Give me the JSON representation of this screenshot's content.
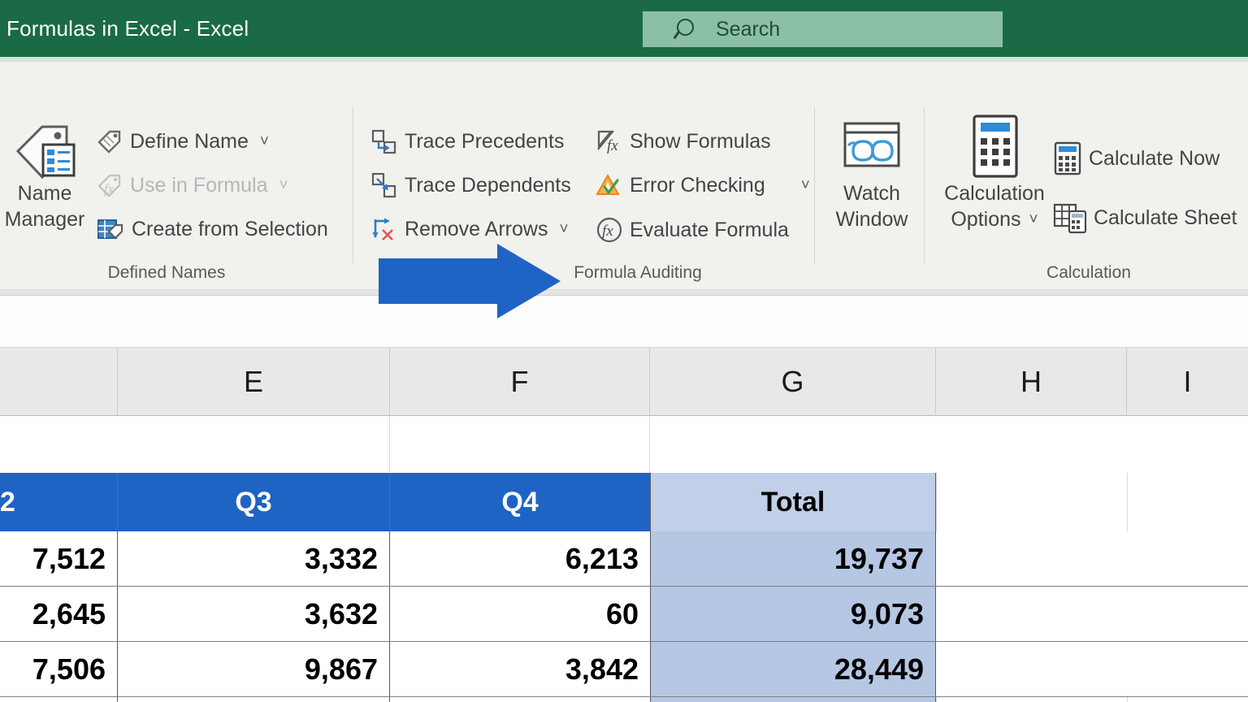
{
  "window": {
    "title": "Formulas in Excel  -  Excel",
    "titlebar_color": "#1a6b45"
  },
  "search": {
    "placeholder": "Search",
    "icon": "search-icon",
    "box_color": "#8cc0a4"
  },
  "ribbon": {
    "tab": "Formulas",
    "groups": [
      {
        "name": "Defined Names",
        "label": "Defined Names",
        "big_button": {
          "line1": "Name",
          "line2": "Manager",
          "icon": "name-manager-tag-icon"
        },
        "items": [
          {
            "label": "Define Name",
            "icon": "tag-icon",
            "has_chevron": true,
            "disabled": false
          },
          {
            "label": "Use in Formula",
            "icon": "tag-fx-icon",
            "has_chevron": true,
            "disabled": true
          },
          {
            "label": "Create from Selection",
            "icon": "grid-tag-icon",
            "has_chevron": false,
            "disabled": false
          }
        ]
      },
      {
        "name": "Formula Auditing",
        "label": "Formula Auditing",
        "items": [
          {
            "label": "Trace Precedents",
            "icon": "trace-precedents-icon",
            "has_chevron": false,
            "disabled": false
          },
          {
            "label": "Trace Dependents",
            "icon": "trace-dependents-icon",
            "has_chevron": false,
            "disabled": false
          },
          {
            "label": "Remove Arrows",
            "icon": "remove-arrows-icon",
            "has_chevron": true,
            "disabled": false
          },
          {
            "label": "Show Formulas",
            "icon": "show-formulas-icon",
            "has_chevron": false,
            "disabled": false
          },
          {
            "label": "Error Checking",
            "icon": "error-checking-icon",
            "has_chevron": true,
            "disabled": false
          },
          {
            "label": "Evaluate Formula",
            "icon": "evaluate-formula-icon",
            "has_chevron": false,
            "disabled": false
          }
        ]
      },
      {
        "name": "Watch Window",
        "big_button": {
          "line1": "Watch",
          "line2": "Window",
          "icon": "watch-window-icon"
        }
      },
      {
        "name": "Calculation",
        "label": "Calculation",
        "big_button": {
          "line1": "Calculation",
          "line2": "Options",
          "icon": "calculator-icon",
          "has_chevron": true
        },
        "items": [
          {
            "label": "Calculate Now",
            "icon": "calculate-now-icon",
            "has_chevron": false,
            "disabled": false
          },
          {
            "label": "Calculate Sheet",
            "icon": "calculate-sheet-icon",
            "has_chevron": false,
            "disabled": false
          }
        ]
      }
    ]
  },
  "annotation": {
    "type": "arrow",
    "direction": "right",
    "color": "#1f63c4",
    "points_at": "Formula Auditing"
  },
  "sheet": {
    "column_headers": [
      "E",
      "F",
      "G",
      "H",
      "I"
    ],
    "table": {
      "header_row": [
        "2",
        "Q3",
        "Q4",
        "Total"
      ],
      "header_colors": {
        "quarter": "#1f63c4",
        "total": "#c2cfe8"
      },
      "total_column_color": "#b6c7e3",
      "rows": [
        [
          "7,512",
          "3,332",
          "6,213",
          "19,737"
        ],
        [
          "2,645",
          "3,632",
          "60",
          "9,073"
        ],
        [
          "7,506",
          "9,867",
          "3,842",
          "28,449"
        ]
      ]
    }
  }
}
